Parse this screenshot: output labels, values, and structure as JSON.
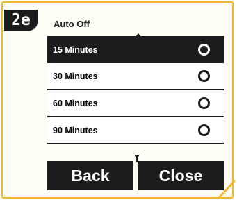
{
  "step": {
    "label": "2e"
  },
  "screen": {
    "title": "Auto Off"
  },
  "options": [
    {
      "label": "15 Minutes",
      "selected": true
    },
    {
      "label": "30 Minutes",
      "selected": false
    },
    {
      "label": "60 Minutes",
      "selected": false
    },
    {
      "label": "90 Minutes",
      "selected": false
    }
  ],
  "buttons": {
    "back": "Back",
    "close": "Close"
  },
  "colors": {
    "frame": "#f2b731",
    "dark": "#1c1c1c",
    "background": "#fffef6"
  },
  "icons": {
    "scroll_up": "triangle-up",
    "scroll_down": "triangle-down",
    "radio": "radio-circle"
  }
}
